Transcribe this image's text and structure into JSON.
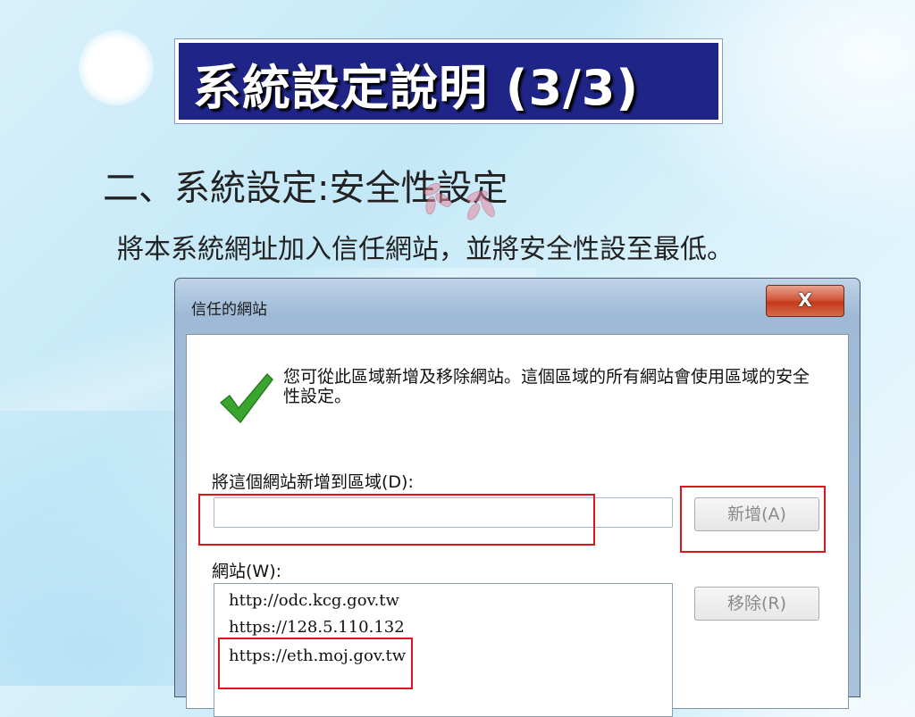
{
  "slide": {
    "title": "系統設定說明 (3/3)",
    "heading": "二、系統設定:安全性設定",
    "subtitle": "將本系統網址加入信任網站，並將安全性設至最低。"
  },
  "dialog": {
    "title": "信任的網站",
    "close_label": "X",
    "info_text": "您可從此區域新增及移除網站。這個區域的所有網站會使用區域的安全性設定。",
    "add_label": "將這個網站新增到區域(D):",
    "add_value": "",
    "add_button": "新增(A)",
    "sites_label": "網站(W):",
    "sites": [
      "http://odc.kcg.gov.tw",
      "https://128.5.110.132",
      "https://eth.moj.gov.tw"
    ],
    "remove_button": "移除(R)"
  },
  "colors": {
    "title_bg": "#1f2586",
    "highlight": "#e0141e",
    "check": "#3aa52e"
  }
}
